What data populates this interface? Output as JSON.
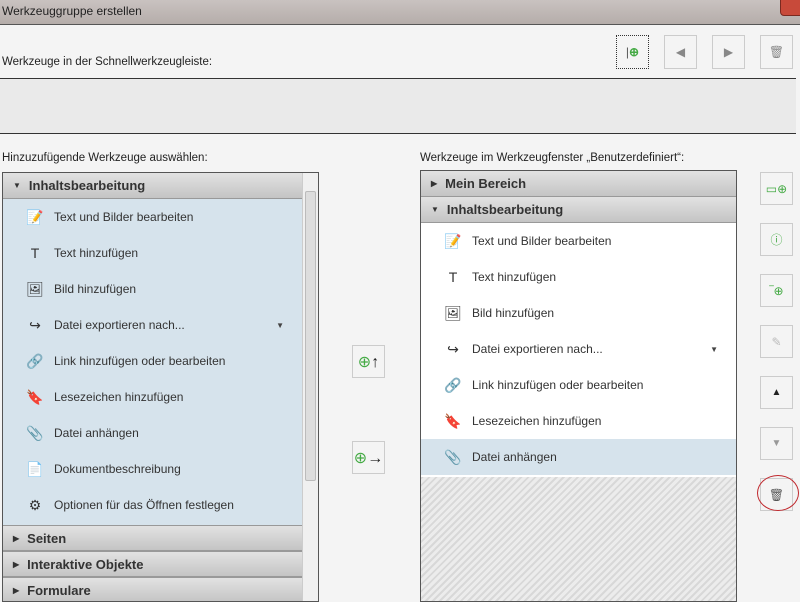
{
  "window": {
    "title": "Werkzeuggruppe erstellen"
  },
  "quick_toolbar": {
    "label": "Werkzeuge in der Schnellwerkzeugleiste:"
  },
  "left": {
    "label": "Hinzuzufügende Werkzeuge auswählen:",
    "expanded": "Inhaltsbearbeitung",
    "items": [
      {
        "label": "Text und Bilder bearbeiten",
        "icon": "edit-text-image-icon",
        "glyph": "📝"
      },
      {
        "label": "Text hinzufügen",
        "icon": "add-text-icon",
        "glyph": "T"
      },
      {
        "label": "Bild hinzufügen",
        "icon": "add-image-icon",
        "glyph": "🖼"
      },
      {
        "label": "Datei exportieren nach...",
        "icon": "export-file-icon",
        "glyph": "↪",
        "dropdown": true
      },
      {
        "label": "Link hinzufügen oder bearbeiten",
        "icon": "link-icon",
        "glyph": "🔗"
      },
      {
        "label": "Lesezeichen hinzufügen",
        "icon": "bookmark-icon",
        "glyph": "🔖"
      },
      {
        "label": "Datei anhängen",
        "icon": "paperclip-icon",
        "glyph": "📎"
      },
      {
        "label": "Dokumentbeschreibung",
        "icon": "document-description-icon",
        "glyph": "📄"
      },
      {
        "label": "Optionen für das Öffnen festlegen",
        "icon": "open-options-icon",
        "glyph": "⚙"
      }
    ],
    "collapsed": [
      "Seiten",
      "Interaktive Objekte",
      "Formulare"
    ]
  },
  "right": {
    "label": "Werkzeuge im Werkzeugfenster „Benutzerdefiniert“:",
    "groups": [
      "Mein Bereich",
      "Inhaltsbearbeitung"
    ],
    "items": [
      {
        "label": "Text und Bilder bearbeiten",
        "icon": "edit-text-image-icon",
        "glyph": "📝"
      },
      {
        "label": "Text hinzufügen",
        "icon": "add-text-icon",
        "glyph": "T"
      },
      {
        "label": "Bild hinzufügen",
        "icon": "add-image-icon",
        "glyph": "🖼"
      },
      {
        "label": "Datei exportieren nach...",
        "icon": "export-file-icon",
        "glyph": "↪",
        "dropdown": true
      },
      {
        "label": "Link hinzufügen oder bearbeiten",
        "icon": "link-icon",
        "glyph": "🔗"
      },
      {
        "label": "Lesezeichen hinzufügen",
        "icon": "bookmark-icon",
        "glyph": "🔖"
      },
      {
        "label": "Datei anhängen",
        "icon": "paperclip-icon",
        "glyph": "📎",
        "selected": true
      }
    ]
  },
  "colors": {
    "selection": "#d6e3ec",
    "highlight_circle": "#c0282d"
  }
}
